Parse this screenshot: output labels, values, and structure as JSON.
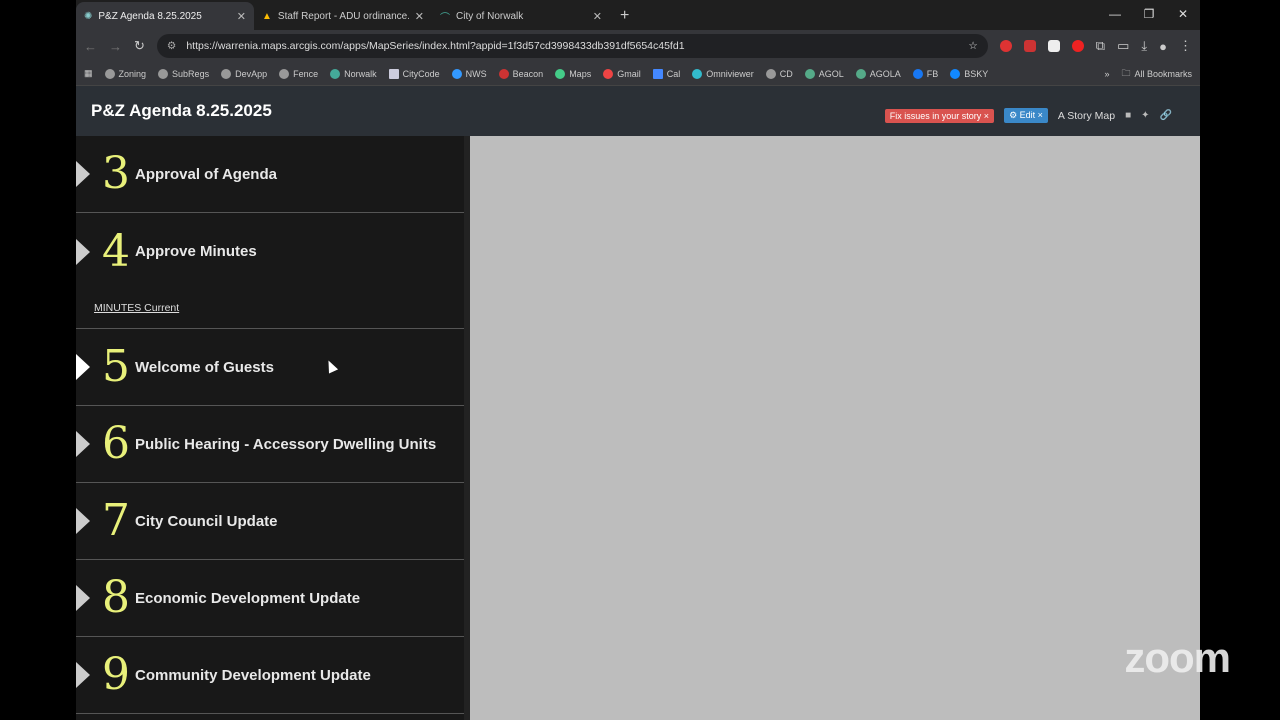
{
  "browser": {
    "tabs": [
      {
        "title": "P&Z Agenda 8.25.2025",
        "active": true
      },
      {
        "title": "Staff Report - ADU ordinance.p",
        "active": false
      },
      {
        "title": "City of Norwalk",
        "active": false
      }
    ],
    "url": "https://warrenia.maps.arcgis.com/apps/MapSeries/index.html?appid=1f3d57cd3998433db391df5654c45fd1",
    "bookmarks": [
      "Zoning",
      "SubRegs",
      "DevApp",
      "Fence",
      "Norwalk",
      "CityCode",
      "NWS",
      "Beacon",
      "Maps",
      "Gmail",
      "Cal",
      "Omniviewer",
      "CD",
      "AGOL",
      "AGOLA",
      "FB",
      "BSKY"
    ],
    "all_bookmarks": "All Bookmarks"
  },
  "story": {
    "title": "P&Z Agenda 8.25.2025",
    "fix_issues": "Fix issues in your story ×",
    "edit": "⚙ Edit ×",
    "story_map": "A Story Map",
    "items": [
      {
        "num": "3",
        "label": "Approval of Agenda"
      },
      {
        "num": "4",
        "label": "Approve Minutes",
        "link": "MINUTES Current"
      },
      {
        "num": "5",
        "label": "Welcome of Guests"
      },
      {
        "num": "6",
        "label": "Public Hearing - Accessory Dwelling Units"
      },
      {
        "num": "7",
        "label": "City Council Update"
      },
      {
        "num": "8",
        "label": "Economic Development Update"
      },
      {
        "num": "9",
        "label": "Community Development Update"
      }
    ]
  },
  "overlay": {
    "zoom_logo": "zoom"
  }
}
